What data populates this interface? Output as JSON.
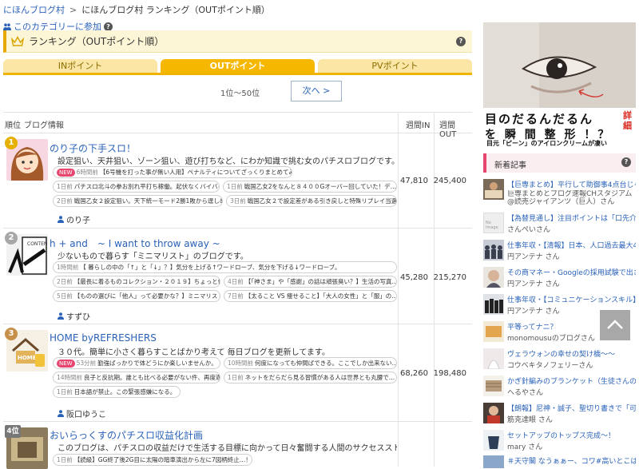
{
  "breadcrumb": {
    "home": "にほんブログ村",
    "sep": ">",
    "current": "にほんブログ村 ランキング（OUTポイント順）"
  },
  "join_label": "このカテゴリーに参加",
  "ranking_title": "ランキング（OUTポイント順）",
  "tabs": [
    {
      "label": "INポイント"
    },
    {
      "label": "OUTポイント",
      "active": true
    },
    {
      "label": "PVポイント"
    }
  ],
  "pager": {
    "range": "1位〜50位",
    "next": "次へ >"
  },
  "headers": {
    "rank": "順位",
    "blog": "ブログ情報",
    "in": "週間IN",
    "out": "週間OUT"
  },
  "rows": [
    {
      "rank": "1",
      "title": "のり子の下手スロ！",
      "desc": "設定狙い、天井狙い、ゾーン狙い、遊び打ちなど、にわか知識で挑む女のパチスロブログです。",
      "articles": [
        {
          "new": "NEW",
          "date": "6時間前",
          "text": "【6号機を打った事が無い人用】ペナルティについてざっくりまとめてみた。"
        },
        {
          "date": "1日前",
          "text": "パチスロ北斗の拳お別れ平打ち稼働。起伏なくバイバイ！"
        },
        {
          "date": "1日前",
          "text": "戦国乙女2をなんと８４００Gオーバー回していた！デ…"
        },
        {
          "date": "2日前",
          "text": "戦国乙女２設定狙い。天下統一モード2勝1敗から逞しめ…"
        },
        {
          "date": "3日前",
          "text": "戦国乙女２で設定差がある引き戻しと特殊リプレイ当選…"
        }
      ],
      "author": "のり子",
      "in": "47,810",
      "out": "245,400"
    },
    {
      "rank": "2",
      "title": "h + and　~ I want to throw away ~",
      "desc": "少ないもので暮らす「ミニマリスト」のブログです。",
      "articles": [
        {
          "date": "1時間前",
          "text": "【 暮らしの中の「↑」と「↓」？】気分を上げる↑ワードローブ、気分を下げる↓ワードローブ。"
        },
        {
          "date": "2日前",
          "text": "【最長に着るものコレクション・２０１９】ちょっと侮…"
        },
        {
          "date": "4日前",
          "text": "【「神さま」や「感謝」の話は頑張臭い？】生活の写真…"
        },
        {
          "date": "5日前",
          "text": "【ものの選びに「他人」って必要かな？】ミニマリストの…"
        },
        {
          "date": "7日前",
          "text": "【太ること VS 痩せること】「大人の女性」と「服」の…"
        }
      ],
      "author": "すずひ",
      "in": "45,280",
      "out": "215,270"
    },
    {
      "rank": "3",
      "title": "HOME byREFRESHERS",
      "desc": "３０代。簡単に小さく暮らすことばかり考えて 毎日ブログを更新してます。",
      "articles": [
        {
          "new": "NEW",
          "date": "53分前",
          "text": "勤強ばっかりで体どうにか楽しいませんか。"
        },
        {
          "date": "10時間前",
          "text": "何度になっても仲間ばできる。ここでしか出来ない…"
        },
        {
          "date": "14時間前",
          "text": "良子と反抗期。誰とも比べる必要がない件、再度適…"
        },
        {
          "date": "1日前",
          "text": "ネットをだらだら見る習慣がある人は世界とも丸腰で…"
        },
        {
          "date": "1日前",
          "text": "日本語が禁止。この緊張感嫌になる。"
        }
      ],
      "author": "阪口ゆうこ",
      "in": "68,260",
      "out": "198,480"
    },
    {
      "rank": "4位",
      "title": "おいらっくすのパチスロ収益化計画",
      "desc": "このブログは、パチスロの収益だけで生活する目標に向かって日々奮闘する人間のサクセスストーリー…",
      "articles": [
        {
          "date": "1日前",
          "text": "【読級】GG終了後2G目に太陽の暗車演出から左に7図柄終止…！！"
        }
      ],
      "author": "",
      "in": "",
      "out": ""
    }
  ],
  "ad": {
    "line1": "目のだるんだるん",
    "line2": "を 瞬 間 整 形 ！？",
    "line3": "目元「ピーン」のアイロンクリームが凄い",
    "detail": "詳細"
  },
  "news": {
    "title": "新着記事",
    "items": [
      {
        "title": "【巨専まとめ】平行して助御事4点台じゃな…",
        "source": "巨専まとめとブログ速報CHスタジアム@読売ジャイアンツ（巨人）さん"
      },
      {
        "title": "【為替見通し】注目ポイントは「口先介入…",
        "source": "さんぺいさん",
        "noimg": true
      },
      {
        "title": "仕事年収・【清報】日本、人口過去最大43…",
        "source": "円アンテナ さん"
      },
      {
        "title": "その商マネー・Googleの採用試験で出さ…",
        "source": "円アンテナ さん"
      },
      {
        "title": "仕事年収・【コミュニケーションスキル】…",
        "source": "円アンテナ さん"
      },
      {
        "title": "平等ってナニ？",
        "source": "monomousuのブログさん"
      },
      {
        "title": "ヴェラウォンの幸せの契け橋〜〜",
        "source": "コウベキタノフェリーさん"
      },
      {
        "title": "かぎ針編みのブランケット（生徒さんの作…",
        "source": "へるやさん"
      },
      {
        "title": "【朗報】尼神・誠子、聖切り書きで「可愛…",
        "source": "筋克達眼 さん"
      },
      {
        "title": "セットアップのトップス完成〜！",
        "source": "mary さん"
      },
      {
        "title": "＃天守閣 なうぁぁー、コワ#高いとこは苦…",
        "source": ""
      }
    ]
  },
  "no_image_label": "No Image"
}
